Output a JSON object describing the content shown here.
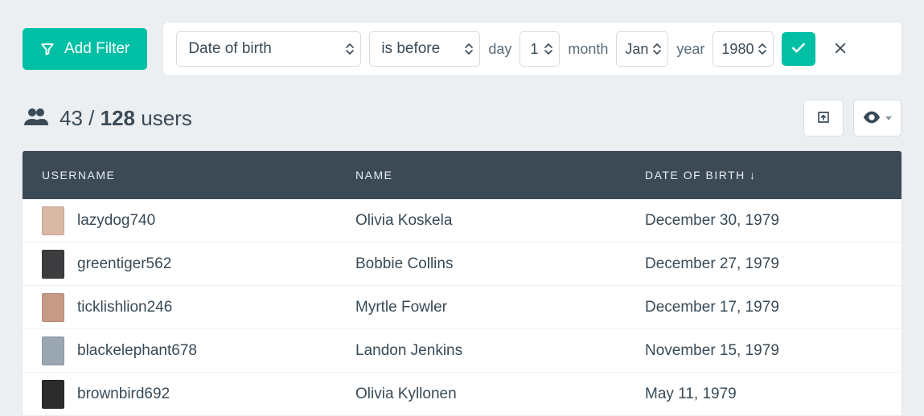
{
  "toolbar": {
    "add_filter_label": "Add Filter"
  },
  "filter": {
    "field": "Date of birth",
    "condition": "is before",
    "day_label": "day",
    "day_value": "1",
    "month_label": "month",
    "month_value": "Jan",
    "year_label": "year",
    "year_value": "1980"
  },
  "summary": {
    "filtered": "43",
    "separator": "/",
    "total": "128",
    "unit": "users"
  },
  "columns": {
    "username": "Username",
    "name": "Name",
    "dob": "Date of birth ↓"
  },
  "rows": [
    {
      "avatar_color": "#d9b9a6",
      "username": "lazydog740",
      "name": "Olivia Koskela",
      "dob": "December 30, 1979"
    },
    {
      "avatar_color": "#3d3d3f",
      "username": "greentiger562",
      "name": "Bobbie Collins",
      "dob": "December 27, 1979"
    },
    {
      "avatar_color": "#c79a86",
      "username": "ticklishlion246",
      "name": "Myrtle Fowler",
      "dob": "December 17, 1979"
    },
    {
      "avatar_color": "#9aa7b3",
      "username": "blackelephant678",
      "name": "Landon Jenkins",
      "dob": "November 15, 1979"
    },
    {
      "avatar_color": "#2b2b2b",
      "username": "brownbird692",
      "name": "Olivia Kyllonen",
      "dob": "May 11, 1979"
    }
  ]
}
